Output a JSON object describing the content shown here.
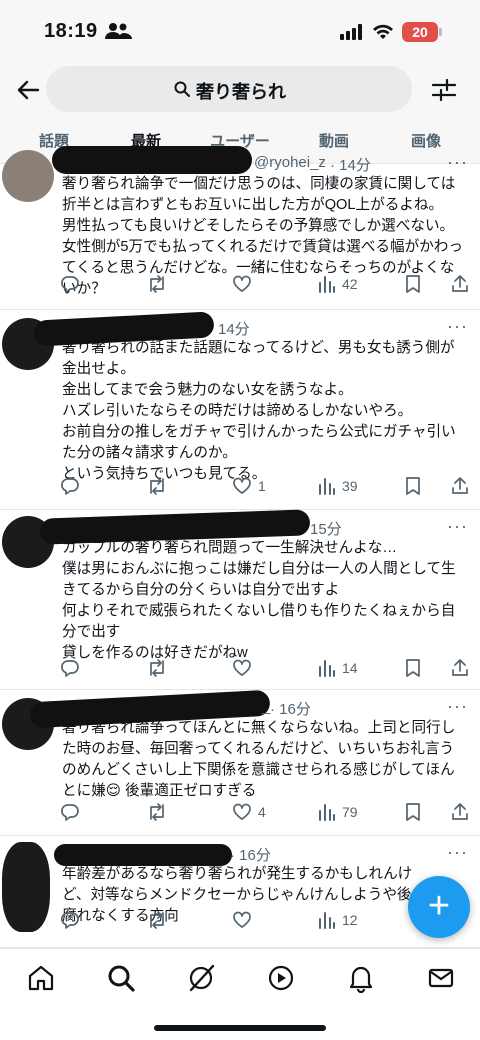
{
  "status_bar": {
    "time": "18:19",
    "battery": "20"
  },
  "search": {
    "query": "奢り奢られ"
  },
  "tabs": [
    {
      "label": "話題"
    },
    {
      "label": "最新"
    },
    {
      "label": "ユーザー"
    },
    {
      "label": "動画"
    },
    {
      "label": "画像"
    }
  ],
  "active_tab": "最新",
  "posts": [
    {
      "handle_fragment": "@ryohei_z",
      "time": "· 14分",
      "text": "奢り奢られ論争で一個だけ思うのは、同棲の家賃に関しては折半とは言わずともお互いに出した方がQOL上がるよね。\n男性払っても良いけどそしたらその予算感でしか選べない。\n女性側が5万でも払ってくれるだけで賃貸は選べる幅がかわってくると思うんだけどな。一緒に住むならそっちのがよくないか？",
      "replies": "",
      "reposts": "",
      "likes": "",
      "views": "42"
    },
    {
      "handle_fragment": "",
      "time": "14分",
      "text": "奢り奢られの話また話題になってるけど、男も女も誘う側が金出せよ。\n金出してまで会う魅力のない女を誘うなよ。\nハズレ引いたならその時だけは諦めるしかないやろ。\nお前自分の推しをガチャで引けんかったら公式にガチャ引いた分の諸々請求すんのか。\nという気持ちでいつも見てる。",
      "replies": "",
      "reposts": "",
      "likes": "1",
      "views": "39"
    },
    {
      "handle_fragment": "",
      "time": "15分",
      "text": "カップルの奢り奢られ問題って一生解決せんよな…\n僕は男におんぶに抱っこは嫌だし自分は一人の人間として生きてるから自分の分くらいは自分で出すよ\n何よりそれで威張られたくないし借りも作りたくねぇから自分で出す\n貸しを作るのは好きだがねw",
      "replies": "",
      "reposts": "",
      "likes": "",
      "views": "14"
    },
    {
      "handle_fragment": "_",
      "time": "· 16分",
      "text": "奢り奢られ論争ってほんとに無くならないね。上司と同行した時のお昼、毎回奢ってくれるんだけど、いちいちお礼言うのめんどくさいし上下関係を意識させられる感じがしてほんとに嫌😌 後輩適正ゼロすぎる",
      "replies": "",
      "reposts": "",
      "likes": "4",
      "views": "79"
    },
    {
      "handle_fragment": "",
      "time": "· 16分",
      "text": "年齢差があるなら奢り奢られが発生するかもしれんけど、対等ならメンドクセーからじゃんけんしようや後腐れなくする方向",
      "replies": "",
      "reposts": "",
      "likes": "",
      "views": "12"
    }
  ],
  "fab": {
    "label": "+"
  },
  "bottom_nav": [
    "home-icon",
    "search-icon",
    "grok-icon",
    "video-icon",
    "notifications-icon",
    "messages-icon"
  ],
  "colors": {
    "accent": "#1d9bf0",
    "text": "#0f1419",
    "muted": "#536471"
  }
}
